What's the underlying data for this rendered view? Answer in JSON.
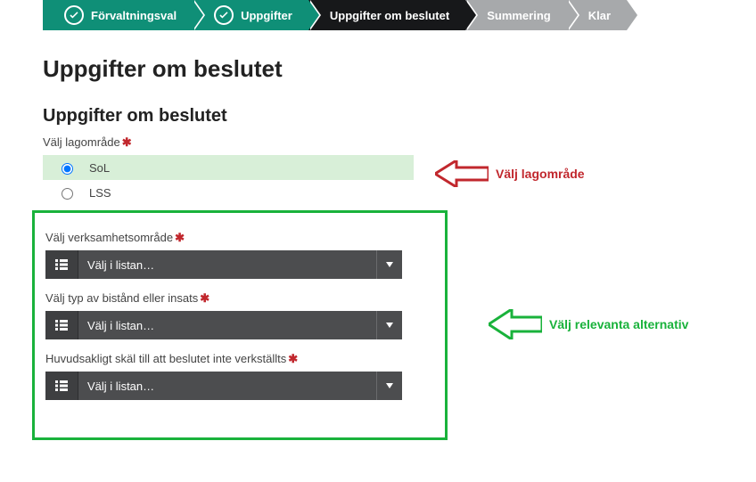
{
  "steps": {
    "s1": "Förvaltningsval",
    "s2": "Uppgifter",
    "s3": "Uppgifter om beslutet",
    "s4": "Summering",
    "s5": "Klar"
  },
  "title": "Uppgifter om beslutet",
  "subtitle": "Uppgifter om beslutet",
  "lagomrade": {
    "label": "Välj lagområde",
    "opt1": "SoL",
    "opt2": "LSS"
  },
  "verksamhet_label": "Välj verksamhetsområde",
  "bistand_label": "Välj typ av bistånd eller insats",
  "skal_label": "Huvudsakligt skäl till att beslutet inte verkställts",
  "dd_placeholder": "Välj i listan…",
  "annot_lagomrade": "Välj lagområde",
  "annot_relevant": "Välj relevanta alternativ"
}
